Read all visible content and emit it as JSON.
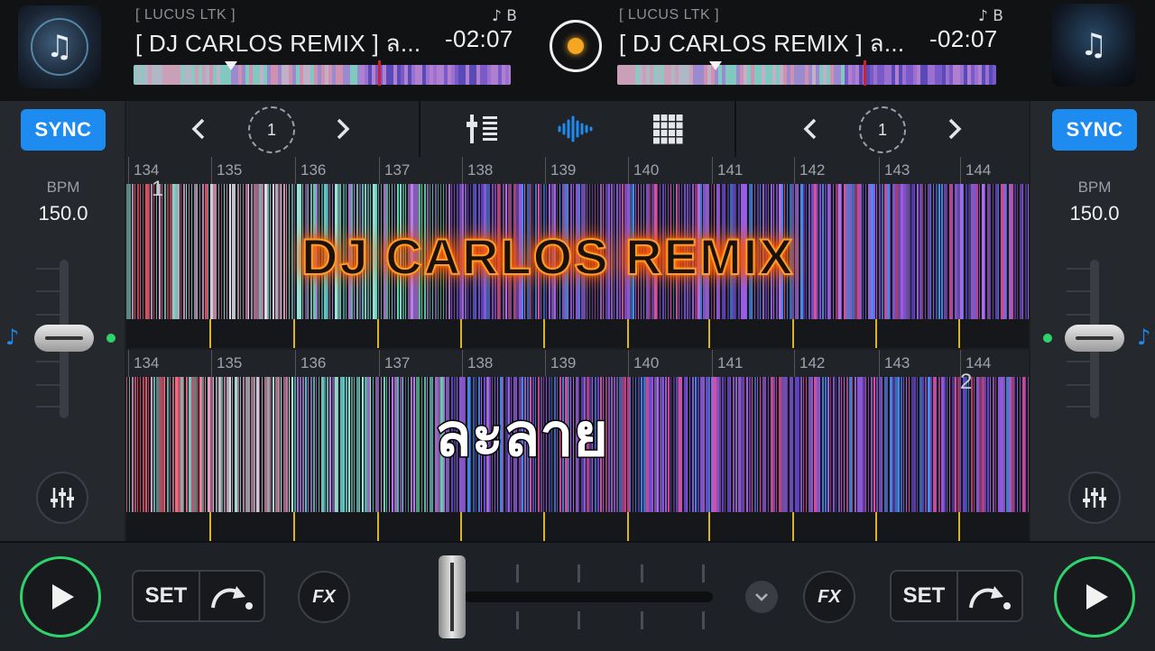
{
  "deck_left": {
    "artist": "[ LUCUS LTK ]",
    "title": "[  DJ CARLOS REMIX ]  ล...",
    "time": "-02:07",
    "key_tag": "♪ B",
    "sync_label": "SYNC",
    "bpm_label": "BPM",
    "bpm_value": "150.0",
    "loop_count": "1",
    "cue_marker": "1",
    "set_label": "SET",
    "fx_label": "FX"
  },
  "deck_right": {
    "artist": "[ LUCUS LTK ]",
    "title": "[  DJ CARLOS REMIX ]  ล...",
    "time": "-02:07",
    "key_tag": "♪ B",
    "sync_label": "SYNC",
    "bpm_label": "BPM",
    "bpm_value": "150.0",
    "loop_count": "1",
    "cue_marker": "2",
    "set_label": "SET",
    "fx_label": "FX"
  },
  "beat_numbers": [
    "134",
    "135",
    "136",
    "137",
    "138",
    "139",
    "140",
    "141",
    "142",
    "143",
    "144"
  ],
  "overlay": {
    "banner": "DJ  CARLOS REMIX",
    "thai_text": "ละลาย"
  },
  "icons": {
    "prev": "chevron-left-icon",
    "next": "chevron-right-icon",
    "loop": "loop-icon",
    "mixer": "mixer-icon",
    "waveform": "waveform-icon",
    "grid": "grid-icon",
    "eq": "eq-sliders-icon",
    "cue_jump": "cue-jump-icon",
    "chevron_down": "chevron-down-icon",
    "play": "play-icon"
  },
  "colors": {
    "sync": "#1d8bf0",
    "play_ring": "#2fd36b",
    "accent_orange": "#f5a623",
    "playhead_red": "#d3202d"
  }
}
